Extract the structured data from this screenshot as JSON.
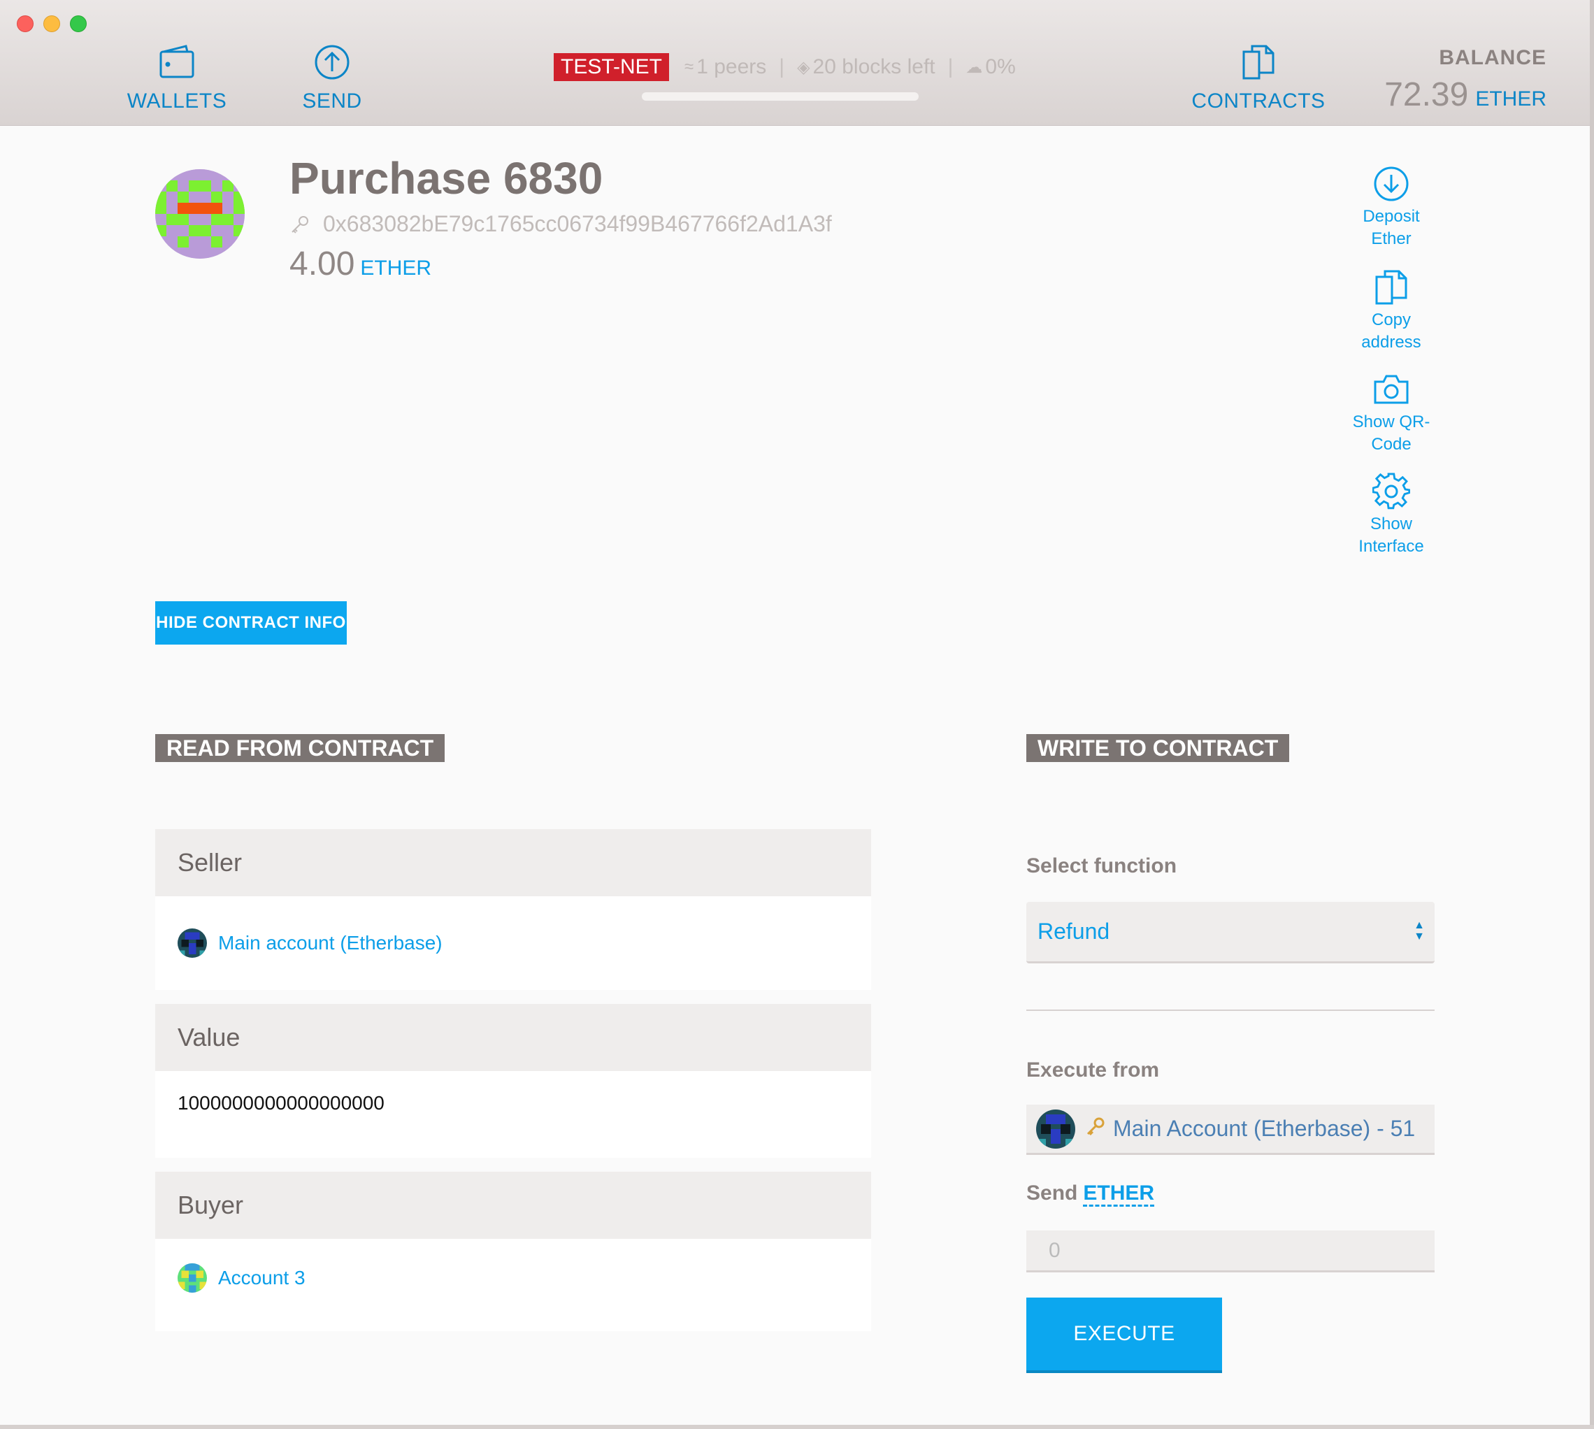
{
  "header": {
    "nav": {
      "wallets": "WALLETS",
      "send": "SEND",
      "contracts": "CONTRACTS"
    },
    "network": "TEST-NET",
    "peers": "1 peers",
    "blocks_left": "20 blocks left",
    "sync_percent": "0%",
    "balance_label": "BALANCE",
    "balance_amount": "72.39",
    "balance_unit": "ETHER"
  },
  "contract": {
    "title": "Purchase 6830",
    "address": "0x683082bE79c1765cc06734f99B467766f2Ad1A3f",
    "balance_amount": "4.00",
    "balance_unit": "ETHER"
  },
  "actions": {
    "deposit": "Deposit Ether",
    "copy": "Copy address",
    "qr": "Show QR-Code",
    "interface": "Show Interface"
  },
  "hide_button": "HIDE CONTRACT INFO",
  "read": {
    "title": "READ FROM CONTRACT",
    "seller_label": "Seller",
    "seller_value": "Main account (Etherbase)",
    "value_label": "Value",
    "value_value": "1000000000000000000",
    "buyer_label": "Buyer",
    "buyer_value": "Account 3"
  },
  "write": {
    "title": "WRITE TO CONTRACT",
    "select_label": "Select function",
    "select_value": "Refund",
    "execute_from_label": "Execute from",
    "execute_from_value": "Main Account (Etherbase) - 51",
    "send_label": "Send",
    "send_unit": "ETHER",
    "send_placeholder": "0",
    "execute_button": "EXECUTE"
  },
  "colors": {
    "accent": "#0ca7ef",
    "link": "#0c9ee8",
    "testnet": "#d0202b",
    "section_header": "#7b7472"
  },
  "icons": [
    "wallet-icon",
    "send-icon",
    "contracts-icon",
    "deposit-icon",
    "copy-icon",
    "camera-icon",
    "gear-icon",
    "key-icon"
  ]
}
